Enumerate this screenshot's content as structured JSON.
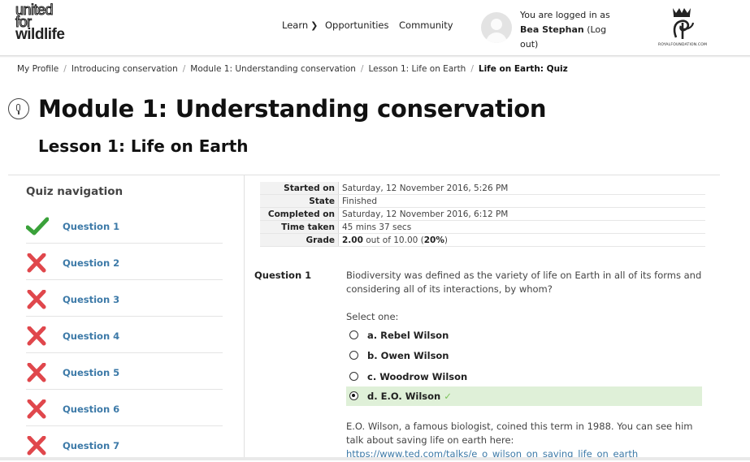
{
  "header": {
    "logo_line1": "united",
    "logo_line2": "for",
    "logo_line3": "wildlife",
    "nav": {
      "learn": "Learn",
      "opportunities": "Opportunities",
      "community": "Community"
    },
    "login_prefix": "You are logged in as",
    "user_name": "Bea Stephan",
    "logout_label": "(Log out)",
    "partner_caption": "ROYALFOUNDATION.COM"
  },
  "breadcrumb": {
    "items": [
      "My Profile",
      "Introducing conservation",
      "Module 1: Understanding conservation",
      "Lesson 1: Life on Earth"
    ],
    "current": "Life on Earth: Quiz",
    "separator": "/"
  },
  "page": {
    "title": "Module 1: Understanding conservation",
    "subtitle": "Lesson 1: Life on Earth"
  },
  "quiz_nav": {
    "title": "Quiz navigation",
    "questions": [
      {
        "label": "Question 1",
        "status": "correct"
      },
      {
        "label": "Question 2",
        "status": "incorrect"
      },
      {
        "label": "Question 3",
        "status": "incorrect"
      },
      {
        "label": "Question 4",
        "status": "incorrect"
      },
      {
        "label": "Question 5",
        "status": "incorrect"
      },
      {
        "label": "Question 6",
        "status": "incorrect"
      },
      {
        "label": "Question 7",
        "status": "incorrect"
      }
    ]
  },
  "summary": {
    "started_label": "Started on",
    "started_value": "Saturday, 12 November 2016, 5:26 PM",
    "state_label": "State",
    "state_value": "Finished",
    "completed_label": "Completed on",
    "completed_value": "Saturday, 12 November 2016, 6:12 PM",
    "time_label": "Time taken",
    "time_value": "45 mins 37 secs",
    "grade_label": "Grade",
    "grade_score": "2.00",
    "grade_mid": " out of 10.00 (",
    "grade_pct": "20%",
    "grade_end": ")"
  },
  "question": {
    "number_label": "Question 1",
    "text": "Biodiversity was defined as the variety of life on Earth in all of its forms and considering all of its interactions, by whom?",
    "prompt": "Select one:",
    "options": [
      {
        "label": "a. Rebel Wilson",
        "selected": false
      },
      {
        "label": "b. Owen Wilson",
        "selected": false
      },
      {
        "label": "c. Woodrow Wilson",
        "selected": false
      },
      {
        "label": "d. E.O. Wilson",
        "selected": true
      }
    ],
    "feedback_text": "E.O. Wilson, a famous biologist, coined this term in 1988. You can see him talk about saving life on earth here:",
    "feedback_link": "https://www.ted.com/talks/e_o_wilson_on_saving_life_on_earth"
  },
  "colors": {
    "correct_green": "#3aa13a",
    "incorrect_red": "#e0474c",
    "link_blue": "#3d7aa8",
    "correct_bg": "#dff0d8"
  },
  "icons": {
    "nav_caret": "chevron-down-icon",
    "correct": "check-icon",
    "incorrect": "cross-icon",
    "module": "module-icon"
  }
}
